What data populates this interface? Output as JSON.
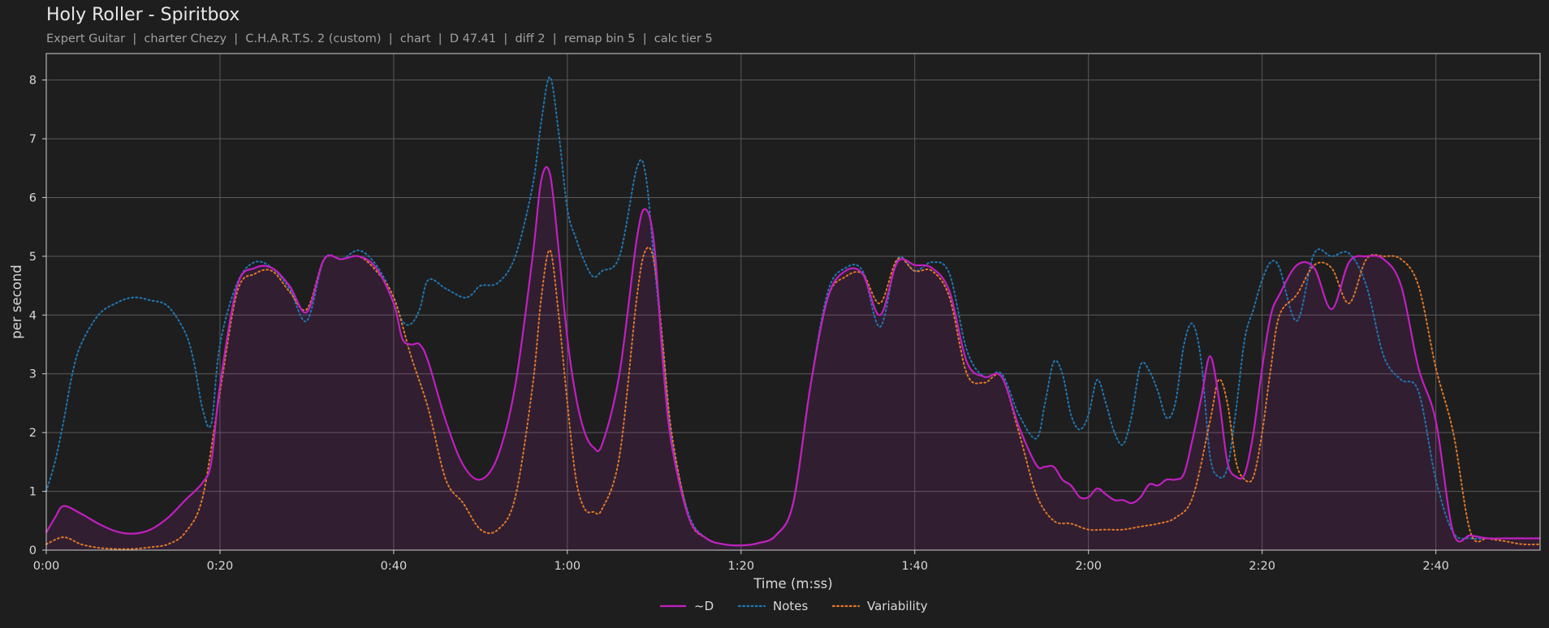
{
  "title": "Holy Roller - Spiritbox",
  "subtitle": "Expert Guitar  |  charter Chezy  |  C.H.A.R.T.S. 2 (custom)  |  chart  |  D 47.41  |  diff 2  |  remap bin 5  |  calc tier 5",
  "chart_data": {
    "type": "line",
    "xlabel": "Time (m:ss)",
    "ylabel": "per second",
    "xlim": [
      0,
      172
    ],
    "ylim": [
      0,
      8.45
    ],
    "x_ticks": [
      0,
      20,
      40,
      60,
      80,
      100,
      120,
      140,
      160
    ],
    "x_tick_labels": [
      "0:00",
      "0:20",
      "0:40",
      "1:00",
      "1:20",
      "1:40",
      "2:00",
      "2:20",
      "2:40"
    ],
    "y_ticks": [
      0,
      1,
      2,
      3,
      4,
      5,
      6,
      7,
      8
    ],
    "y_tick_labels": [
      "0",
      "1",
      "2",
      "3",
      "4",
      "5",
      "6",
      "7",
      "8"
    ],
    "grid": true,
    "legend_position": "bottom-center",
    "background_color": "#1e1e1e",
    "series": [
      {
        "name": "~D",
        "color": "#c020c0",
        "style": "solid",
        "fill": true,
        "x": [
          0,
          1,
          2,
          4,
          6,
          8,
          10,
          12,
          14,
          16,
          18,
          19,
          20,
          22,
          24,
          26,
          28,
          30,
          32,
          34,
          36,
          38,
          40,
          41,
          42,
          43,
          44,
          46,
          48,
          50,
          52,
          54,
          56,
          57,
          58,
          59,
          60,
          61,
          62,
          63,
          64,
          66,
          68,
          69,
          70,
          71,
          72,
          74,
          76,
          78,
          80,
          82,
          84,
          86,
          88,
          90,
          92,
          94,
          96,
          98,
          100,
          102,
          104,
          106,
          108,
          110,
          112,
          114,
          115,
          116,
          117,
          118,
          119,
          120,
          121,
          122,
          123,
          124,
          125,
          126,
          127,
          128,
          129,
          130,
          131,
          132,
          133,
          134,
          135,
          136,
          137,
          138,
          139,
          140,
          141,
          142,
          144,
          146,
          148,
          150,
          152,
          154,
          156,
          158,
          160,
          162,
          164,
          166,
          168,
          170,
          172
        ],
        "y": [
          0.3,
          0.55,
          0.75,
          0.62,
          0.45,
          0.32,
          0.28,
          0.35,
          0.55,
          0.85,
          1.15,
          1.5,
          2.8,
          4.5,
          4.8,
          4.8,
          4.5,
          4.05,
          4.95,
          4.95,
          5.0,
          4.8,
          4.2,
          3.6,
          3.5,
          3.5,
          3.2,
          2.2,
          1.45,
          1.2,
          1.6,
          2.8,
          5.0,
          6.3,
          6.4,
          5.1,
          3.6,
          2.6,
          2.0,
          1.75,
          1.8,
          3.0,
          5.3,
          5.8,
          5.2,
          3.2,
          1.8,
          0.55,
          0.2,
          0.1,
          0.08,
          0.12,
          0.25,
          0.8,
          2.8,
          4.3,
          4.75,
          4.7,
          4.0,
          4.9,
          4.85,
          4.8,
          4.4,
          3.2,
          2.95,
          2.95,
          2.1,
          1.45,
          1.42,
          1.42,
          1.2,
          1.1,
          0.9,
          0.9,
          1.05,
          0.95,
          0.85,
          0.85,
          0.8,
          0.9,
          1.12,
          1.1,
          1.2,
          1.2,
          1.3,
          1.9,
          2.6,
          3.3,
          2.6,
          1.5,
          1.25,
          1.3,
          2.0,
          3.1,
          4.0,
          4.35,
          4.85,
          4.8,
          4.1,
          4.9,
          5.0,
          4.95,
          4.5,
          3.1,
          2.2,
          0.3,
          0.25,
          0.2,
          0.2,
          0.2,
          0.2
        ]
      },
      {
        "name": "Notes",
        "color": "#1f77b4",
        "style": "dotted",
        "fill": false,
        "x": [
          0,
          1,
          2,
          3,
          4,
          6,
          8,
          10,
          12,
          14,
          16,
          17,
          18,
          19,
          20,
          22,
          24,
          26,
          28,
          30,
          32,
          34,
          36,
          38,
          40,
          41,
          42,
          43,
          44,
          46,
          48,
          49,
          50,
          52,
          54,
          56,
          57,
          58,
          59,
          60,
          61,
          62,
          63,
          64,
          66,
          68,
          69,
          70,
          71,
          72,
          74,
          76,
          78,
          80,
          82,
          84,
          86,
          88,
          90,
          92,
          94,
          96,
          98,
          100,
          102,
          104,
          106,
          108,
          110,
          112,
          114,
          115,
          116,
          117,
          118,
          119,
          120,
          121,
          122,
          123,
          124,
          125,
          126,
          127,
          128,
          129,
          130,
          131,
          132,
          133,
          134,
          135,
          136,
          137,
          138,
          139,
          140,
          141,
          142,
          144,
          146,
          148,
          150,
          152,
          154,
          156,
          158,
          160,
          162,
          164,
          166,
          168,
          170,
          172
        ],
        "y": [
          1.0,
          1.5,
          2.2,
          3.0,
          3.5,
          4.0,
          4.2,
          4.3,
          4.25,
          4.15,
          3.7,
          3.2,
          2.4,
          2.15,
          3.5,
          4.55,
          4.9,
          4.8,
          4.45,
          3.9,
          4.95,
          4.95,
          5.1,
          4.85,
          4.3,
          3.9,
          3.85,
          4.1,
          4.6,
          4.45,
          4.3,
          4.35,
          4.5,
          4.55,
          5.0,
          6.2,
          7.3,
          8.05,
          7.1,
          5.8,
          5.3,
          4.9,
          4.65,
          4.75,
          5.0,
          6.5,
          6.4,
          4.9,
          3.4,
          1.9,
          0.6,
          0.2,
          0.1,
          0.08,
          0.12,
          0.25,
          0.8,
          2.8,
          4.4,
          4.8,
          4.75,
          3.8,
          4.95,
          4.75,
          4.9,
          4.7,
          3.4,
          2.95,
          3.0,
          2.3,
          1.9,
          2.5,
          3.2,
          3.0,
          2.3,
          2.05,
          2.3,
          2.9,
          2.5,
          2.0,
          1.8,
          2.3,
          3.15,
          3.05,
          2.7,
          2.25,
          2.5,
          3.5,
          3.85,
          3.2,
          1.6,
          1.25,
          1.4,
          2.4,
          3.6,
          4.1,
          4.6,
          4.9,
          4.8,
          3.9,
          5.05,
          5.0,
          5.05,
          4.5,
          3.3,
          2.9,
          2.7,
          1.2,
          0.3,
          0.2,
          0.2,
          0.2,
          0.2,
          0.2
        ]
      },
      {
        "name": "Variability",
        "color": "#e07828",
        "style": "dotted",
        "fill": false,
        "x": [
          0,
          2,
          4,
          6,
          8,
          10,
          12,
          14,
          16,
          18,
          20,
          22,
          24,
          26,
          28,
          30,
          32,
          34,
          36,
          38,
          40,
          42,
          44,
          46,
          48,
          50,
          52,
          54,
          56,
          57,
          58,
          59,
          60,
          61,
          62,
          63,
          64,
          66,
          68,
          69,
          70,
          71,
          72,
          74,
          76,
          78,
          80,
          82,
          84,
          86,
          88,
          90,
          92,
          94,
          96,
          98,
          100,
          102,
          104,
          106,
          108,
          110,
          112,
          114,
          116,
          118,
          120,
          122,
          124,
          126,
          128,
          130,
          132,
          134,
          135,
          136,
          137,
          138,
          139,
          140,
          141,
          142,
          144,
          146,
          148,
          150,
          152,
          154,
          156,
          158,
          160,
          162,
          164,
          166,
          168,
          170,
          172
        ],
        "y": [
          0.1,
          0.22,
          0.1,
          0.04,
          0.02,
          0.02,
          0.05,
          0.1,
          0.3,
          0.9,
          2.7,
          4.4,
          4.7,
          4.75,
          4.4,
          4.1,
          4.95,
          4.95,
          5.0,
          4.75,
          4.3,
          3.3,
          2.4,
          1.2,
          0.8,
          0.35,
          0.35,
          0.9,
          2.8,
          4.3,
          5.1,
          4.0,
          2.5,
          1.2,
          0.7,
          0.65,
          0.7,
          1.6,
          4.3,
          5.1,
          4.9,
          3.5,
          2.0,
          0.55,
          0.2,
          0.1,
          0.08,
          0.12,
          0.25,
          0.8,
          2.8,
          4.3,
          4.65,
          4.7,
          4.2,
          4.95,
          4.75,
          4.75,
          4.3,
          3.0,
          2.85,
          2.95,
          2.0,
          0.95,
          0.5,
          0.45,
          0.35,
          0.35,
          0.35,
          0.4,
          0.45,
          0.55,
          0.9,
          2.2,
          2.9,
          2.5,
          1.5,
          1.2,
          1.25,
          2.0,
          3.1,
          4.0,
          4.35,
          4.85,
          4.8,
          4.2,
          4.95,
          5.0,
          4.95,
          4.5,
          3.1,
          2.0,
          0.3,
          0.2,
          0.15,
          0.1,
          0.1
        ]
      }
    ]
  }
}
